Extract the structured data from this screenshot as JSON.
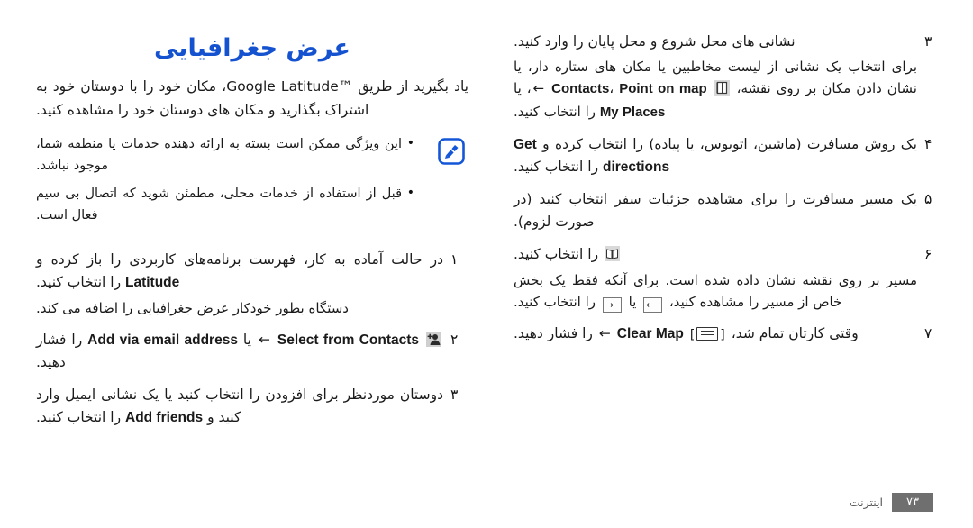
{
  "document": {
    "language": "fa",
    "accent_color": "#1452d0",
    "footer": {
      "label": "اینترنت",
      "page_number": "۷۳"
    }
  },
  "left_column": {
    "section_title": "عرض جغرافیایی",
    "intro": "یاد بگیرید از طریق ™Google Latitude، مکان خود را با دوستان خود به اشتراک بگذارید و مکان های دوستان خود را مشاهده کنید.",
    "note": {
      "icon": "note-pencil-icon",
      "bullets": [
        "این ویژگی ممکن است بسته به ارائه دهنده خدمات یا منطقه شما، موجود نباشد.",
        "قبل از استفاده از خدمات محلی، مطمئن شوید که اتصال بی سیم فعال است."
      ]
    },
    "steps": [
      {
        "num": "۱",
        "text_before": "در حالت آماده به کار، فهرست برنامه‌های کاربردی را باز کرده و",
        "bold_term": "Latitude",
        "text_after": "را انتخاب کنید.",
        "substep": "دستگاه بطور خودکار عرض جغرافیایی را اضافه می کند."
      },
      {
        "num": "۲",
        "icon": "add-friend-icon",
        "arrow": "←",
        "bold_term_1": "Select from Contacts",
        "conj": "یا",
        "bold_term_2": "Add via email address",
        "text_after": "را فشار دهید."
      },
      {
        "num": "۳",
        "text_before": "دوستان موردنظر برای افزودن را انتخاب کنید یا یک نشانی ایمیل وارد کنید و",
        "bold_term": "Add friends",
        "text_after": "را انتخاب کنید."
      }
    ]
  },
  "right_column": {
    "steps": [
      {
        "num": "۳",
        "text": "نشانی های محل شروع و محل پایان را وارد کنید.",
        "substep_before": "برای انتخاب یک نشانی از لیست مخاطبین یا مکان های ستاره دار، یا نشان دادن مکان بر روی نقشه،",
        "icon": "contacts-book-icon",
        "arrow": "←",
        "bold_term_1": "Contacts",
        "bold_term_2": "Point on map",
        "conj": "یا",
        "bold_term_3": "My Places",
        "substep_after": "را انتخاب کنید."
      },
      {
        "num": "۴",
        "text_before": "یک روش مسافرت (ماشین، اتوبوس، یا پیاده) را انتخاب کرده و",
        "bold_term": "Get directions",
        "text_after": "را انتخاب کنید."
      },
      {
        "num": "۵",
        "text": "یک مسیر مسافرت را برای مشاهده جزئیات سفر انتخاب کنید (در صورت لزوم)."
      },
      {
        "num": "۶",
        "icon": "map-book-icon",
        "text_after": "را انتخاب کنید.",
        "substep_before": "مسیر بر روی نقشه نشان داده شده است. برای آنکه فقط یک بخش خاص از مسیر را مشاهده کنید،",
        "key_left": "←",
        "conj": "یا",
        "key_right": "→",
        "substep_after": "را انتخاب کنید."
      },
      {
        "num": "۷",
        "text_before": "وقتی کارتان تمام شد،",
        "menu_key": "[≡]",
        "arrow": "←",
        "bold_term": "Clear Map",
        "text_after": "را فشار دهید."
      }
    ]
  }
}
